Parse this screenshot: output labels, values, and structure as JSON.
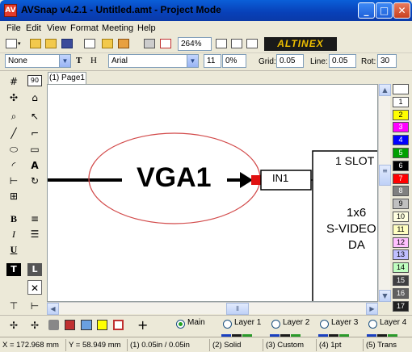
{
  "window": {
    "title": "AVSnap v4.2.1 - Untitled.amt  - Project Mode",
    "app_icon": "AV"
  },
  "menu": [
    "File",
    "Edit",
    "View",
    "Format",
    "Meeting",
    "Help"
  ],
  "toolbar": {
    "zoom": "264%",
    "logo": "ALTINEX"
  },
  "format_bar": {
    "style_value": "None",
    "text_icon": "T",
    "height_icon": "H",
    "font_value": "Arial",
    "font_size": "11",
    "percent": "0%",
    "grid_label": "Grid:",
    "grid_value": "0.05",
    "line_label": "Line:",
    "line_value": "0.05",
    "rot_label": "Rot:",
    "rot_value": "30"
  },
  "palette_tools": {
    "grid_value": "90",
    "text_tool": "A",
    "bold": "B",
    "italic": "I",
    "underline": "U",
    "text_box": "T",
    "label_box": "L"
  },
  "tabs": [
    "(1) Page1"
  ],
  "canvas": {
    "main_label": "VGA1",
    "port_label": "IN1",
    "block_title": "1 SLOT",
    "block_line1": "1x6",
    "block_line2": "S-VIDEO",
    "block_line3": "DA"
  },
  "colors": {
    "ellipse": "#d24a4a",
    "selection_handle": "#e01010"
  },
  "color_palette": [
    {
      "label": "",
      "color": "#ffffff"
    },
    {
      "label": "1",
      "color": "#ffffff"
    },
    {
      "label": "2",
      "color": "#ffff00"
    },
    {
      "label": "3",
      "color": "#ff00ff"
    },
    {
      "label": "4",
      "color": "#0000ff"
    },
    {
      "label": "5",
      "color": "#00a000"
    },
    {
      "label": "6",
      "color": "#000000"
    },
    {
      "label": "7",
      "color": "#ff0000"
    },
    {
      "label": "8",
      "color": "#808080"
    },
    {
      "label": "9",
      "color": "#c0c0c0"
    },
    {
      "label": "10",
      "color": "#ffffe0"
    },
    {
      "label": "11",
      "color": "#ffffc0"
    },
    {
      "label": "12",
      "color": "#ffc0ff"
    },
    {
      "label": "13",
      "color": "#c0c0ff"
    },
    {
      "label": "14",
      "color": "#c0ffc0"
    },
    {
      "label": "15",
      "color": "#404040"
    },
    {
      "label": "16",
      "color": "#606060"
    },
    {
      "label": "17",
      "color": "#202020"
    }
  ],
  "layers": [
    {
      "label": "Main",
      "selected": true
    },
    {
      "label": "Layer 1",
      "selected": false
    },
    {
      "label": "Layer 2",
      "selected": false
    },
    {
      "label": "Layer 3",
      "selected": false
    },
    {
      "label": "Layer 4",
      "selected": false
    }
  ],
  "bottom_tools": {
    "plus_icon": "+"
  },
  "status": {
    "x": "X = 172.968 mm",
    "y": "Y = 58.949 mm",
    "scale": "(1) 0.05in / 0.05in",
    "line_style": "(2) Solid",
    "custom": "(3) Custom",
    "line_width": "(4) 1pt",
    "trans": "(5) Trans"
  }
}
